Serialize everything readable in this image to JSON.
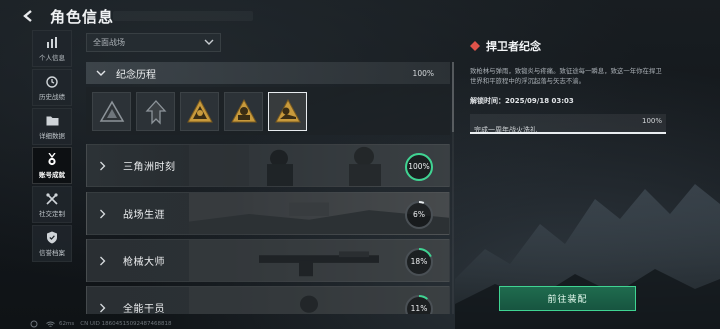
{
  "header": {
    "title": "角色信息"
  },
  "sidebar": {
    "items": [
      {
        "label": "个人信息",
        "icon": "bar-chart-icon",
        "active": false
      },
      {
        "label": "历史战绩",
        "icon": "history-icon",
        "active": false
      },
      {
        "label": "详细数据",
        "icon": "folder-icon",
        "active": false
      },
      {
        "label": "账号成就",
        "icon": "medal-icon",
        "active": true
      },
      {
        "label": "社交定制",
        "icon": "tools-icon",
        "active": false
      },
      {
        "label": "信誉档案",
        "icon": "shield-icon",
        "active": false
      }
    ]
  },
  "filter": {
    "selected": "全面战场"
  },
  "section": {
    "title": "纪念历程",
    "progress": "100%"
  },
  "badges": [
    {
      "icon": "triangle-emblem-icon",
      "state": "locked"
    },
    {
      "icon": "arrowhead-emblem-icon",
      "state": "locked"
    },
    {
      "icon": "gold-warning-emblem-icon",
      "state": "unlocked"
    },
    {
      "icon": "gold-soldier-emblem-icon",
      "state": "unlocked"
    },
    {
      "icon": "gold-soldier-emblem-icon",
      "state": "selected"
    }
  ],
  "achievements": [
    {
      "title": "三角洲时刻",
      "progress": "100%",
      "fraction": 1.0
    },
    {
      "title": "战场生涯",
      "progress": "6%",
      "fraction": 0.06
    },
    {
      "title": "枪械大师",
      "progress": "18%",
      "fraction": 0.18
    },
    {
      "title": "全能干员",
      "progress": "11%",
      "fraction": 0.11
    }
  ],
  "detail": {
    "name": "捍卫者纪念",
    "description": "致枪林与弹雨，致锻炎与疼痛。致征途每一瞬息，致这一年你在捍卫世界和平旅程中的浮沉起落与矢志不渝。",
    "unlock_time": "解锁时间：2025/09/18 03:03",
    "task": {
      "name": "完成一周年战火洗礼",
      "progress": "100%",
      "fraction": 1.0
    },
    "button_label": "前往装配"
  },
  "footer": {
    "ping": "62ms",
    "uid": "CN UID 18604515092487468818"
  },
  "colors": {
    "accent_green": "#3fd492",
    "gold": "#c89a3c",
    "ring_track": "#4a5055"
  }
}
